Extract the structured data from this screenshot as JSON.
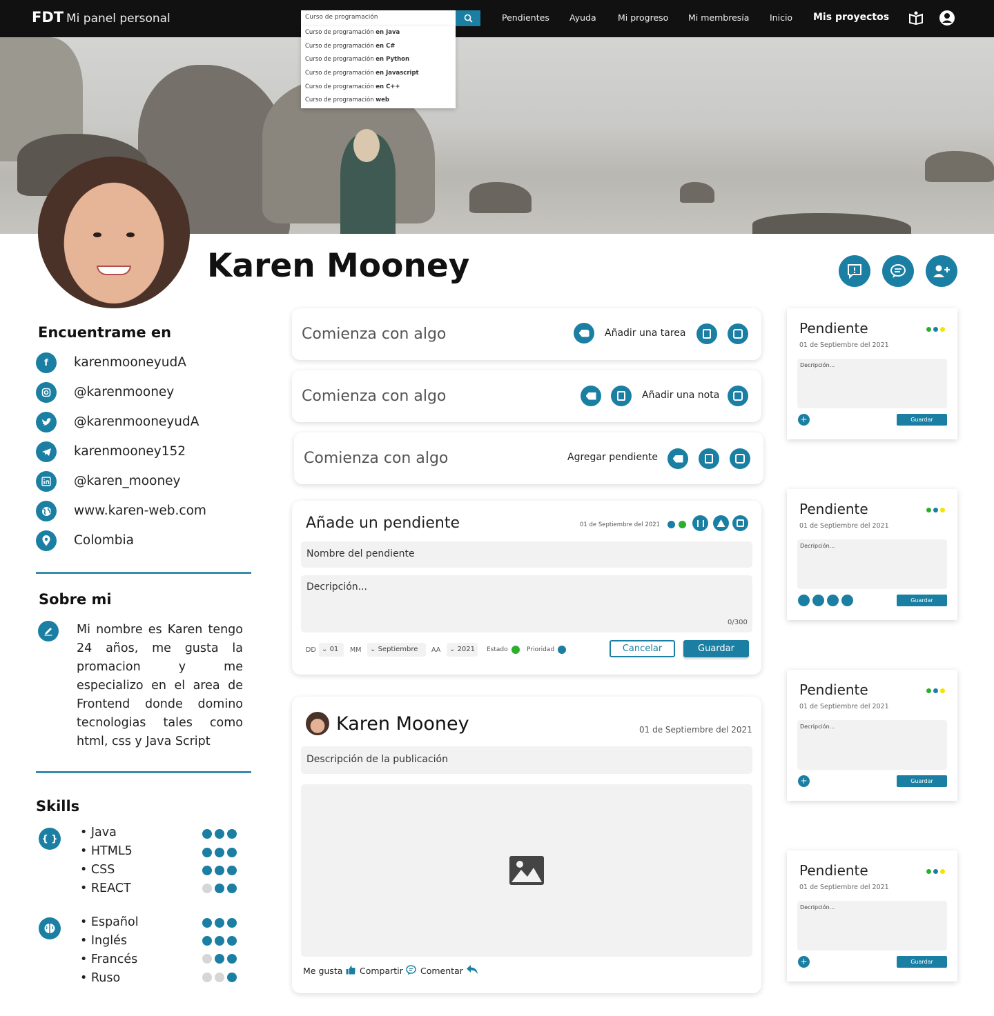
{
  "topbar": {
    "brand": "FDT",
    "title": "Mi panel personal",
    "search_value": "Curso de programación",
    "suggestions": [
      {
        "prefix": "Curso de programación ",
        "bold": "en Java"
      },
      {
        "prefix": "Curso de programación ",
        "bold": "en C#"
      },
      {
        "prefix": "Curso de programación ",
        "bold": "en Python"
      },
      {
        "prefix": "Curso de programación ",
        "bold": "en Javascript"
      },
      {
        "prefix": "Curso de programación ",
        "bold": "en C++"
      },
      {
        "prefix": "Curso de programación ",
        "bold": "web"
      }
    ],
    "nav": [
      "Pendientes",
      "Ayuda",
      "Mi progreso",
      "Mi membresía",
      "Inicio",
      "Mis proyectos"
    ]
  },
  "profile": {
    "name": "Karen Mooney"
  },
  "find_me": {
    "title": "Encuentrame en",
    "items": [
      {
        "icon": "facebook-icon",
        "text": "karenmooneyudA"
      },
      {
        "icon": "instagram-icon",
        "text": "@karenmooney"
      },
      {
        "icon": "twitter-icon",
        "text": "@karenmooneyudA"
      },
      {
        "icon": "telegram-icon",
        "text": "karenmooney152"
      },
      {
        "icon": "linkedin-icon",
        "text": "@karen_mooney"
      },
      {
        "icon": "globe-icon",
        "text": "www.karen-web.com"
      },
      {
        "icon": "location-icon",
        "text": "Colombia"
      }
    ]
  },
  "about": {
    "title": "Sobre mi",
    "text": "Mi nombre es Karen tengo 24 años, me gusta la promacion y me especializo en el area de Frontend donde domino tecnologias tales como html, css y Java Script"
  },
  "skills": {
    "title": "Skills",
    "tech": [
      {
        "name": "Java",
        "level": 3
      },
      {
        "name": "HTML5",
        "level": 3
      },
      {
        "name": "CSS",
        "level": 3
      },
      {
        "name": "REACT",
        "level": 2
      }
    ],
    "languages": [
      {
        "name": "Español",
        "level": 3
      },
      {
        "name": "Inglés",
        "level": 3
      },
      {
        "name": "Francés",
        "level": 2
      },
      {
        "name": "Ruso",
        "level": 1
      }
    ]
  },
  "quick": {
    "placeholder": "Comienza con algo",
    "task_label": "Añadir una tarea",
    "note_label": "Añadir una nota",
    "pending_label": "Agregar pendiente"
  },
  "pending_form": {
    "title": "Añade un pendiente",
    "date": "01 de Septiembre del 2021",
    "name_placeholder": "Nombre del pendiente",
    "desc_placeholder": "Decripción...",
    "counter": "0/300",
    "dd_label": "DD",
    "dd_value": "01",
    "mm_label": "MM",
    "mm_value": "Septiembre",
    "aa_label": "AA",
    "aa_value": "2021",
    "estado_label": "Estado",
    "prioridad_label": "Prioridad",
    "cancel": "Cancelar",
    "save": "Guardar"
  },
  "post": {
    "author": "Karen Mooney",
    "date": "01 de Septiembre del 2021",
    "description": "Descripción de la publicación",
    "like": "Me gusta",
    "share": "Compartir",
    "comment": "Comentar"
  },
  "pending_cards": [
    {
      "title": "Pendiente",
      "date": "01 de Septiembre del 2021",
      "desc": "Decripción...",
      "save": "Guardar"
    },
    {
      "title": "Pendiente",
      "date": "01 de Septiembre del 2021",
      "desc": "Decripción...",
      "save": "Guardar"
    },
    {
      "title": "Pendiente",
      "date": "01 de Septiembre del 2021",
      "desc": "Decripción...",
      "save": "Guardar"
    },
    {
      "title": "Pendiente",
      "date": "01 de Septiembre del 2021",
      "desc": "Decripción...",
      "save": "Guardar"
    }
  ],
  "colors": {
    "accent": "#1a7fa2",
    "topbar": "#111111",
    "green": "#2bb02b",
    "yellow": "#f2e600"
  }
}
